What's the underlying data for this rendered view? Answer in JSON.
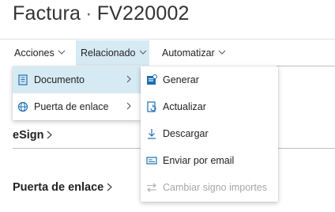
{
  "page": {
    "title_prefix": "Factura",
    "title_separator": "·",
    "title_number": "FV220002"
  },
  "actionbar": {
    "tabs": [
      {
        "label": "Acciones",
        "active": false
      },
      {
        "label": "Relacionado",
        "active": true
      },
      {
        "label": "Automatizar",
        "active": false
      }
    ],
    "chevron_icon": "chevron-down-icon"
  },
  "sections": [
    {
      "title": "eSign",
      "icon": "chevron-right-icon"
    },
    {
      "title": "Puerta de enlace",
      "icon": "chevron-right-icon"
    }
  ],
  "submenu_left": {
    "items": [
      {
        "label": "Documento",
        "icon": "document-icon",
        "highlighted": true
      },
      {
        "label": "Puerta de enlace",
        "icon": "globe-icon",
        "highlighted": false
      }
    ]
  },
  "submenu_right": {
    "items": [
      {
        "label": "Generar",
        "icon": "generate-icon",
        "disabled": false
      },
      {
        "label": "Actualizar",
        "icon": "update-icon",
        "disabled": false
      },
      {
        "label": "Descargar",
        "icon": "download-icon",
        "disabled": false
      },
      {
        "label": "Enviar por email",
        "icon": "email-icon",
        "disabled": false
      },
      {
        "label": "Cambiar signo importes",
        "icon": "swap-arrows-icon",
        "disabled": true
      }
    ]
  },
  "colors": {
    "highlight": "#d6eaf4",
    "icon_blue": "#1e6fb0",
    "disabled_text": "#a6a6a6"
  }
}
